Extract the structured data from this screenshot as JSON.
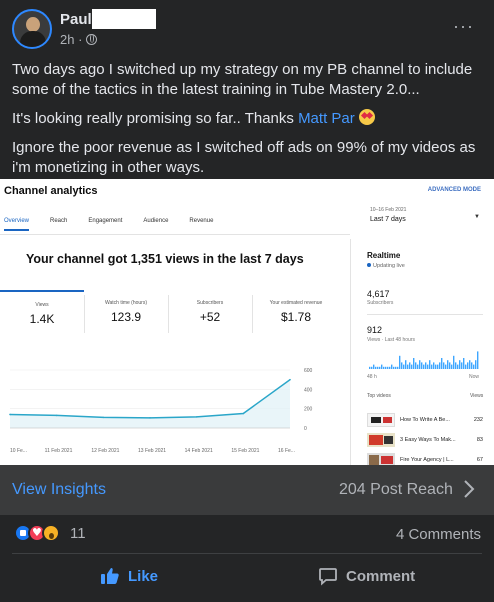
{
  "post": {
    "author": "Paul",
    "time": "2h ·",
    "more": "···",
    "paragraphs": {
      "p1": "Two days ago I switched up my strategy on my PB channel to include some of the tactics in the latest training in Tube Mastery 2.0...",
      "p2_before": "It's looking really promising so far.. Thanks ",
      "p2_mention": "Matt Par",
      "p3": "Ignore the poor revenue as I switched off ads on 99% of my videos as i'm monetizing in other ways."
    }
  },
  "analytics": {
    "title": "Channel analytics",
    "advanced_mode": "ADVANCED MODE",
    "tabs": [
      "Overview",
      "Reach",
      "Engagement",
      "Audience",
      "Revenue"
    ],
    "date_range": "10–16 Feb 2021",
    "date_value": "Last 7 days",
    "headline": "Your channel got 1,351 views in the last 7 days",
    "metrics": [
      {
        "label": "Views",
        "value": "1.4K"
      },
      {
        "label": "Watch time (hours)",
        "value": "123.9"
      },
      {
        "label": "Subscribers",
        "value": "+52"
      },
      {
        "label": "Your estimated revenue",
        "value": "$1.78"
      }
    ],
    "realtime": {
      "title": "Realtime",
      "live": "Updating live",
      "subscribers": "4,617",
      "subscribers_label": "Subscribers",
      "views": "912",
      "views_label": "Views · Last 48 hours",
      "start_label": "48 h",
      "end_label": "Now",
      "top_videos_label": "Top videos",
      "views_header": "Views",
      "videos": [
        {
          "title": "How To Write A Be...",
          "views": "232"
        },
        {
          "title": "3 Easy Ways To Mak...",
          "views": "83"
        },
        {
          "title": "Fire Your Agency | L...",
          "views": "67"
        }
      ]
    }
  },
  "chart_data": {
    "type": "line",
    "x": [
      "10 Fe...",
      "11 Feb 2021",
      "12 Feb 2021",
      "13 Feb 2021",
      "14 Feb 2021",
      "15 Feb 2021",
      "16 Fe..."
    ],
    "series": [
      {
        "values": [
          140,
          130,
          110,
          105,
          115,
          150,
          500
        ]
      }
    ],
    "yticks": [
      "600",
      "400",
      "200",
      "0"
    ],
    "ylim": [
      0,
      600
    ],
    "title": "",
    "xlabel": "",
    "ylabel": "",
    "color": "#2aa6c9"
  },
  "insights": {
    "label": "View Insights",
    "reach": "204 Post Reach"
  },
  "reactions": {
    "count": "11",
    "comments": "4 Comments"
  },
  "actions": {
    "like": "Like",
    "comment": "Comment"
  },
  "colors": {
    "background": "#242526",
    "link": "#4599ff",
    "insights_bar": "#3a3b3c"
  }
}
